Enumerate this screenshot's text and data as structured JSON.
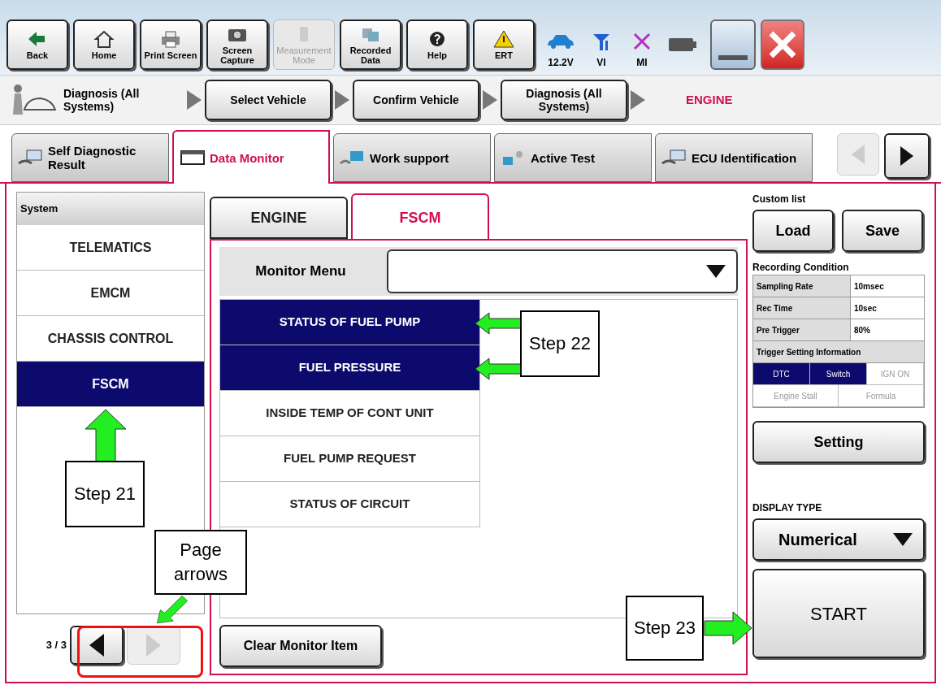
{
  "toolbar": {
    "buttons": [
      {
        "label": "Back",
        "kind": "back",
        "disabled": false
      },
      {
        "label": "Home",
        "kind": "home",
        "disabled": false
      },
      {
        "label": "Print Screen",
        "kind": "print",
        "disabled": false
      },
      {
        "label": "Screen Capture",
        "kind": "camera",
        "disabled": false
      },
      {
        "label": "Measurement Mode",
        "kind": "measure",
        "disabled": true
      },
      {
        "label": "Recorded Data",
        "kind": "recorded",
        "disabled": false
      },
      {
        "label": "Help",
        "kind": "help",
        "disabled": false
      },
      {
        "label": "ERT",
        "kind": "ert",
        "disabled": false
      }
    ],
    "status": [
      {
        "label": "12.2V",
        "kind": "car"
      },
      {
        "label": "VI",
        "kind": "signal"
      },
      {
        "label": "MI",
        "kind": "cross"
      },
      {
        "kind": "battery"
      }
    ]
  },
  "breadcrumb": {
    "title": "Diagnosis (All Systems)",
    "steps": [
      "Select Vehicle",
      "Confirm Vehicle",
      "Diagnosis (All Systems)"
    ],
    "current": "ENGINE"
  },
  "tabs": [
    {
      "label": "Self Diagnostic Result",
      "kind": "diag",
      "selected": false
    },
    {
      "label": "Data Monitor",
      "kind": "monitor",
      "selected": true
    },
    {
      "label": "Work support",
      "kind": "work",
      "selected": false
    },
    {
      "label": "Active Test",
      "kind": "active",
      "selected": false
    },
    {
      "label": "ECU Identification",
      "kind": "ecu",
      "selected": false
    }
  ],
  "system": {
    "heading": "System",
    "items": [
      {
        "label": "TELEMATICS",
        "selected": false
      },
      {
        "label": "EMCM",
        "selected": false
      },
      {
        "label": "CHASSIS CONTROL",
        "selected": false
      },
      {
        "label": "FSCM",
        "selected": true
      }
    ],
    "page": "3 / 3"
  },
  "sub_tabs": [
    {
      "label": "ENGINE",
      "selected": false
    },
    {
      "label": "FSCM",
      "selected": true
    }
  ],
  "monitor_menu": {
    "label": "Monitor Menu"
  },
  "monitor_items": [
    {
      "label": "STATUS OF FUEL PUMP",
      "selected": true
    },
    {
      "label": "FUEL PRESSURE",
      "selected": true
    },
    {
      "label": "INSIDE TEMP OF CONT UNIT",
      "selected": false
    },
    {
      "label": "FUEL PUMP REQUEST",
      "selected": false
    },
    {
      "label": "STATUS OF CIRCUIT",
      "selected": false
    }
  ],
  "clear_button": "Clear Monitor Item",
  "custom_list": {
    "heading": "Custom list",
    "buttons": [
      "Load",
      "Save"
    ]
  },
  "recording_condition": {
    "heading": "Recording Condition",
    "rows": [
      {
        "label": "Sampling Rate",
        "value": "10msec"
      },
      {
        "label": "Rec Time",
        "value": "10sec"
      },
      {
        "label": "Pre Trigger",
        "value": "80%"
      }
    ],
    "trigger_heading": "Trigger Setting Information",
    "triggers": [
      {
        "label": "DTC",
        "selected": true
      },
      {
        "label": "Switch",
        "selected": true
      },
      {
        "label": "IGN ON",
        "selected": false
      },
      {
        "label": "Engine Stall",
        "selected": false
      },
      {
        "label": "Formula",
        "selected": false
      }
    ]
  },
  "setting_button": "Setting",
  "display_type": {
    "heading": "DISPLAY TYPE",
    "value": "Numerical"
  },
  "start_button": "START",
  "callouts": [
    {
      "text": "Step 22"
    },
    {
      "text": "Step 21"
    },
    {
      "text": "Page arrows"
    },
    {
      "text": "Step 23"
    }
  ]
}
